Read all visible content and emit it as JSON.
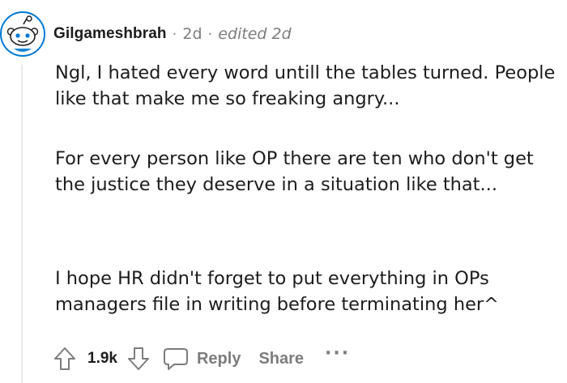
{
  "comment": {
    "username": "Gilgameshbrah",
    "separator": "·",
    "time": "2d",
    "edited": "edited 2d",
    "paragraphs": [
      "Ngl, I hated every word untill the tables turned. People like that make me so freaking angry...",
      "For every person like OP there are ten who don't get the justice they deserve in a situation like that...",
      "I hope HR didn't forget to put everything in OPs managers file in writing before terminating her^"
    ],
    "avatar_icon": "reddit-snoo-avatar-icon",
    "colors": {
      "avatar_ring": "#0079d3",
      "text_primary": "#1c1c1c",
      "text_muted": "#7c7c7c",
      "thread_line": "#eaeaea"
    }
  },
  "actions": {
    "upvote_icon": "upvote-arrow-icon",
    "vote_count": "1.9k",
    "downvote_icon": "downvote-arrow-icon",
    "reply_icon": "comment-bubble-icon",
    "reply_label": "Reply",
    "share_label": "Share",
    "more_label": "···"
  }
}
